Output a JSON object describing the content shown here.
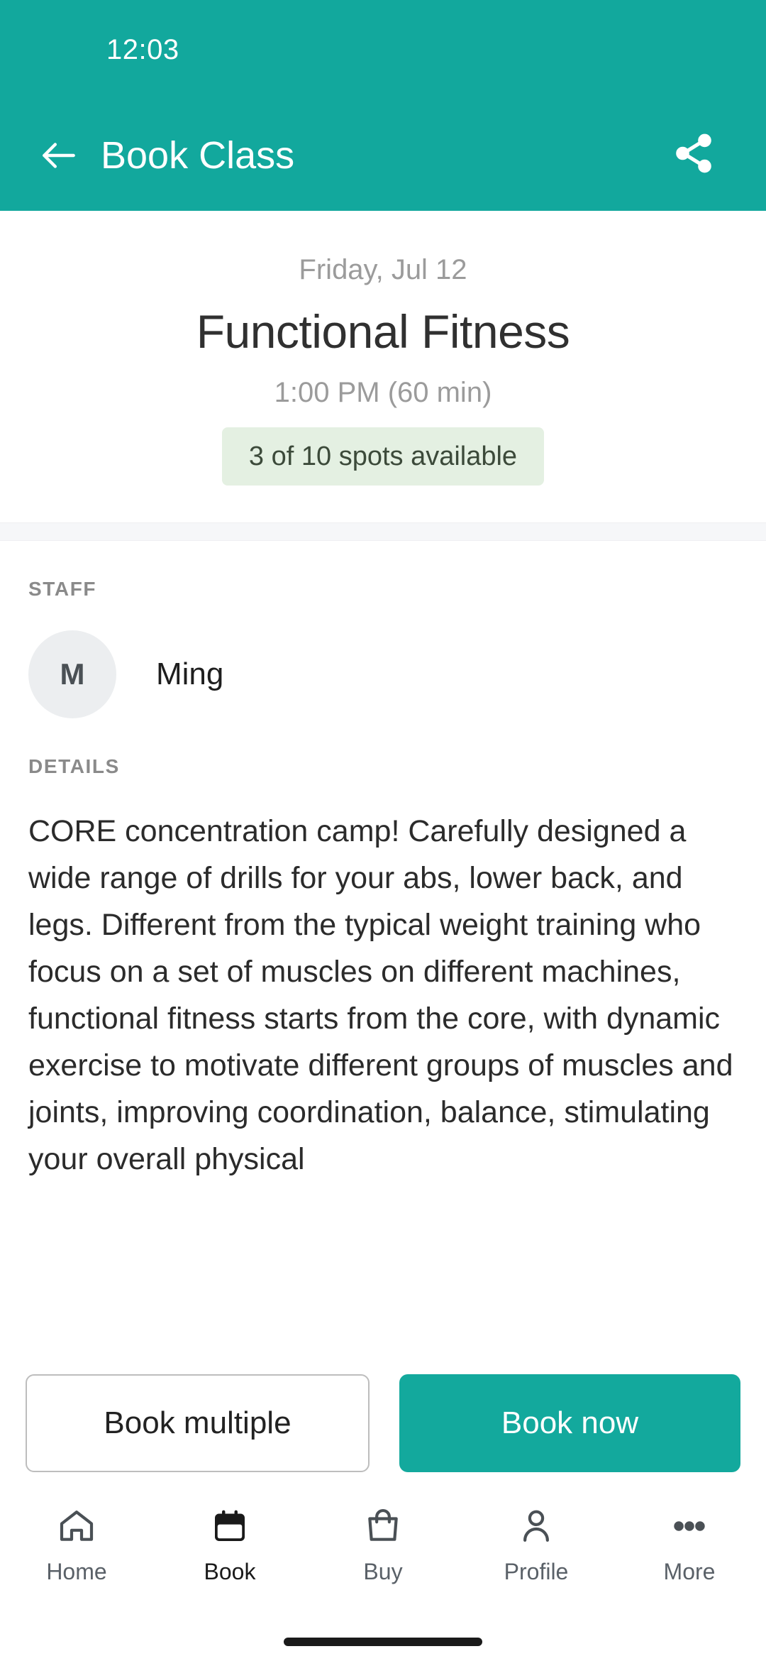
{
  "status_bar": {
    "clock": "12:03"
  },
  "app_bar": {
    "title": "Book Class",
    "back_icon": "arrow-left-icon",
    "share_icon": "share-icon"
  },
  "hero": {
    "date": "Friday, Jul 12",
    "class_name": "Functional Fitness",
    "time_duration": "1:00 PM (60 min)",
    "spots_badge": "3 of 10 spots available",
    "spots_available": 3,
    "spots_total": 10
  },
  "staff": {
    "section_label": "STAFF",
    "avatar_initial": "M",
    "name": "Ming"
  },
  "details": {
    "section_label": "DETAILS",
    "text": "CORE concentration camp! Carefully designed a wide range of drills for your abs, lower back, and legs. Different from the typical weight training who focus on a set of muscles on different machines, functional fitness starts from the core, with dynamic exercise to motivate different groups of muscles and joints, improving coordination, balance, stimulating your overall physical"
  },
  "actions": {
    "secondary_label": "Book multiple",
    "primary_label": "Book now"
  },
  "bottom_nav": {
    "items": [
      {
        "label": "Home",
        "icon": "home-icon",
        "active": false
      },
      {
        "label": "Book",
        "icon": "calendar-icon",
        "active": true
      },
      {
        "label": "Buy",
        "icon": "bag-icon",
        "active": false
      },
      {
        "label": "Profile",
        "icon": "person-icon",
        "active": false
      },
      {
        "label": "More",
        "icon": "ellipsis-icon",
        "active": false
      }
    ]
  },
  "colors": {
    "brand_teal": "#12A89D",
    "primary_button": "#13A99D",
    "badge_background": "#E4F0E2",
    "badge_text": "#3C4A3A",
    "muted_text": "#9B9B9B",
    "body_text": "#2B2B2B"
  }
}
